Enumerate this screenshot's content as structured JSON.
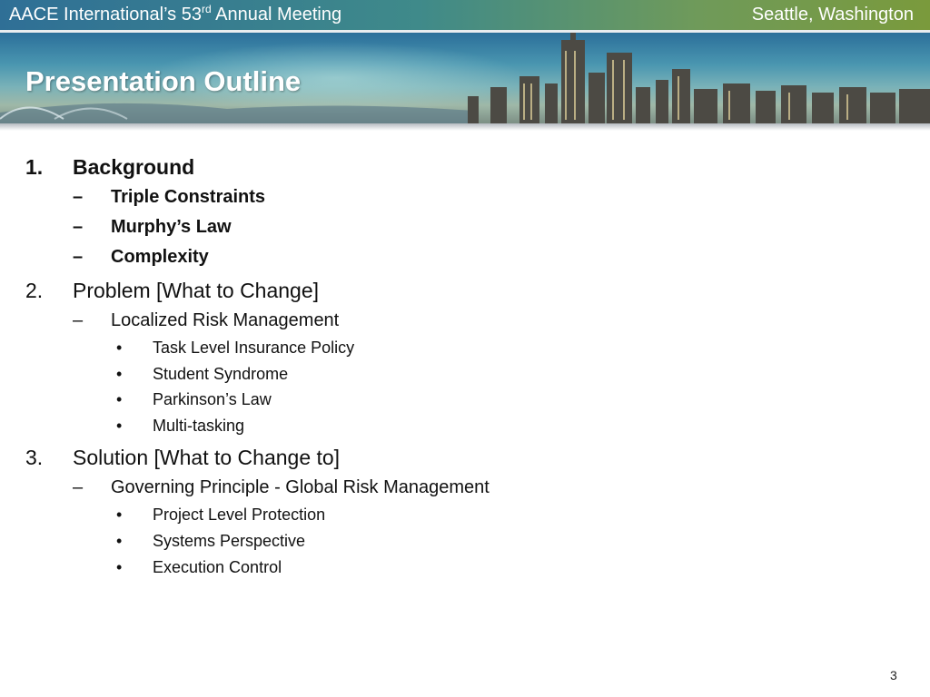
{
  "header": {
    "event_prefix": "AACE International’s 53",
    "event_sup": "rd",
    "event_suffix": " Annual Meeting",
    "location": "Seattle, Washington"
  },
  "slide": {
    "title": "Presentation Outline",
    "page_number": "3"
  },
  "outline": {
    "item1": {
      "number": "1.",
      "label": "Background",
      "subs": [
        {
          "mark": "–",
          "label": "Triple Constraints"
        },
        {
          "mark": "–",
          "label": "Murphy’s Law"
        },
        {
          "mark": "–",
          "label": "Complexity"
        }
      ]
    },
    "item2": {
      "number": "2.",
      "label": "Problem [What to Change]",
      "sub": {
        "mark": "–",
        "label": "Localized Risk Management"
      },
      "bullets": [
        {
          "mark": "•",
          "label": "Task Level Insurance Policy"
        },
        {
          "mark": "•",
          "label": "Student Syndrome"
        },
        {
          "mark": "•",
          "label": "Parkinson’s Law"
        },
        {
          "mark": "•",
          "label": "Multi-tasking"
        }
      ]
    },
    "item3": {
      "number": "3.",
      "label": "Solution [What to Change to]",
      "sub": {
        "mark": "–",
        "label": "Governing Principle - Global Risk Management"
      },
      "bullets": [
        {
          "mark": "•",
          "label": "Project Level Protection"
        },
        {
          "mark": "•",
          "label": "Systems Perspective"
        },
        {
          "mark": "•",
          "label": "Execution Control"
        }
      ]
    }
  },
  "colors": {
    "header_bar_start": "#2f6f96",
    "header_bar_end": "#7a9a3c",
    "title_text": "#ffffff",
    "body_text": "#111111"
  }
}
